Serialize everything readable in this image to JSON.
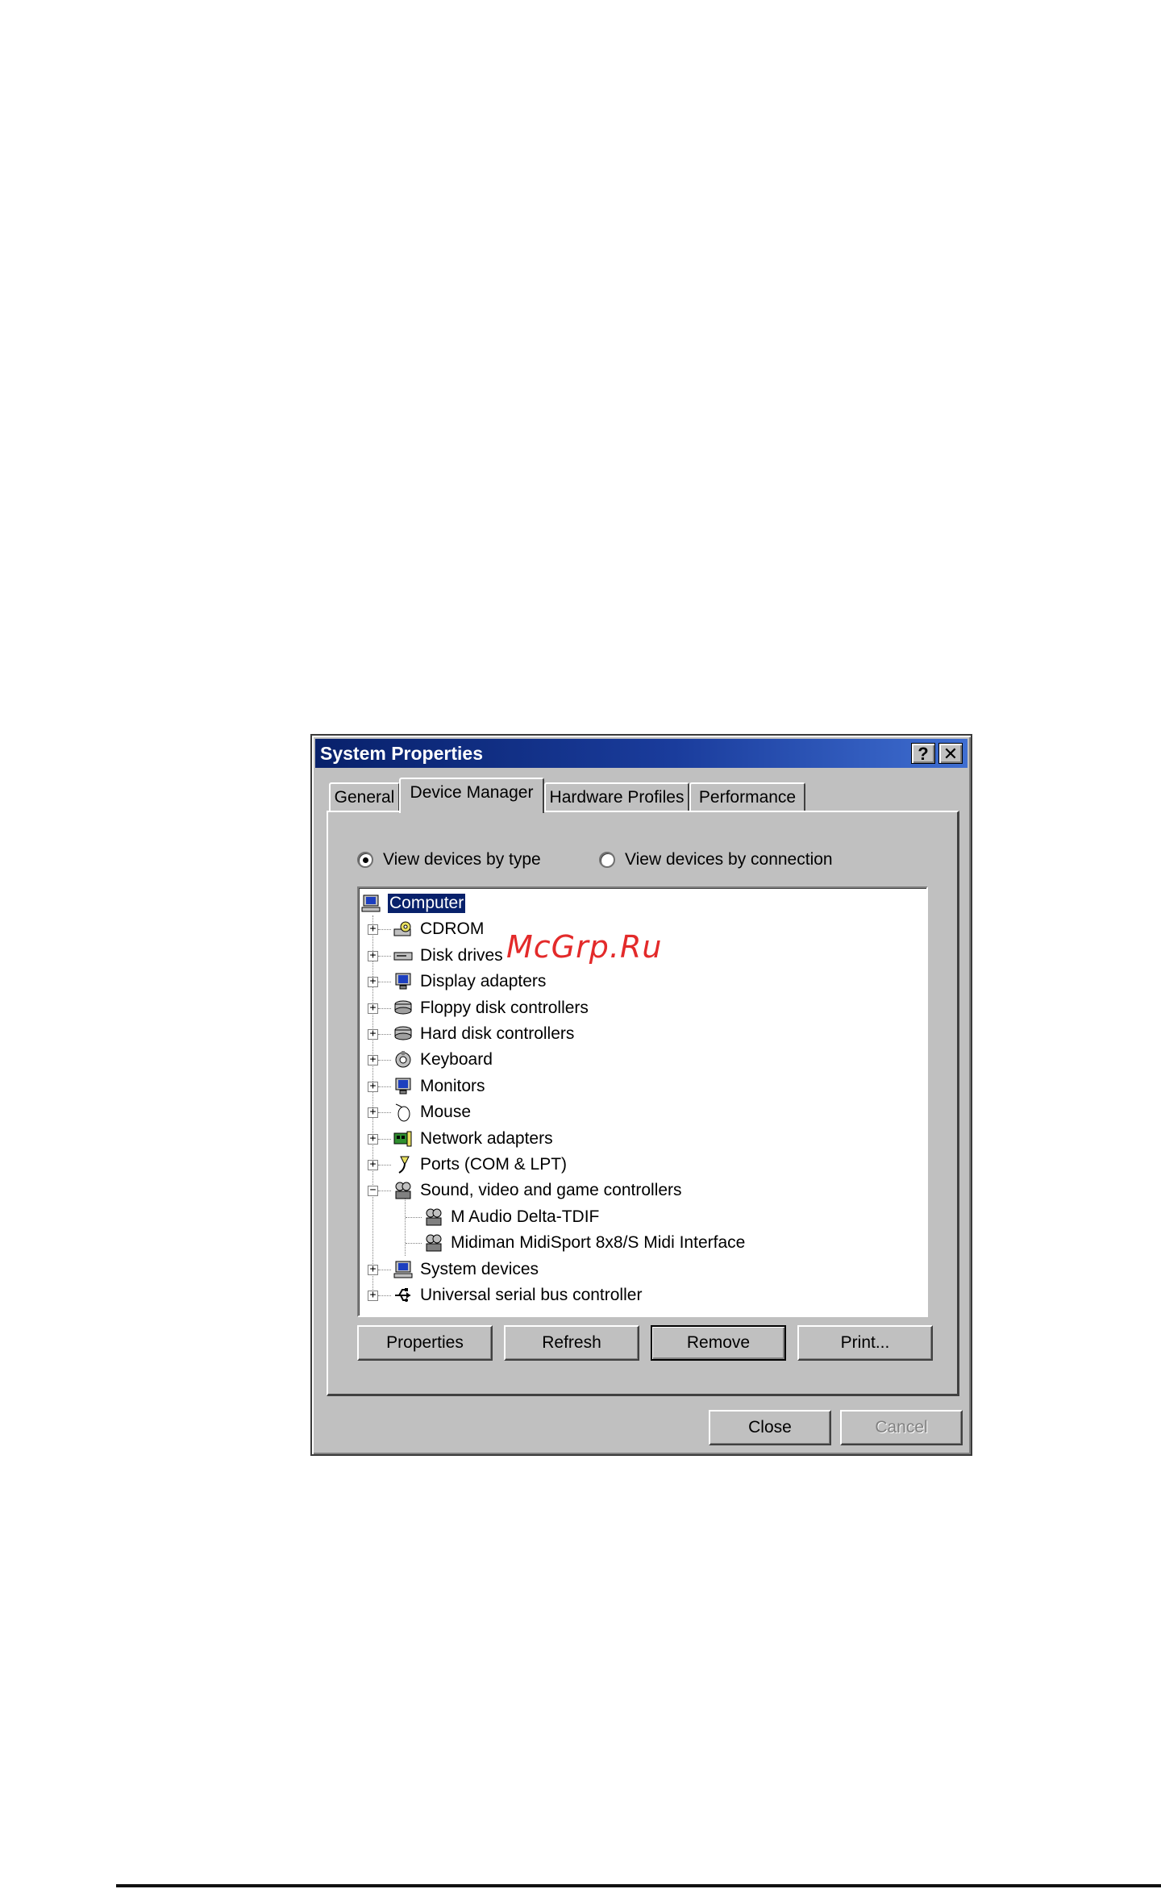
{
  "window": {
    "title": "System Properties",
    "help_glyph": "?",
    "close_glyph": "✕"
  },
  "tabs": [
    {
      "label": "General",
      "active": false
    },
    {
      "label": "Device Manager",
      "active": true
    },
    {
      "label": "Hardware Profiles",
      "active": false
    },
    {
      "label": "Performance",
      "active": false
    }
  ],
  "view_options": {
    "by_type": {
      "label": "View devices by type",
      "checked": true
    },
    "by_connection": {
      "label": "View devices by connection",
      "checked": false
    }
  },
  "tree": {
    "root": {
      "label": "Computer",
      "icon": "computer-icon",
      "selected": true
    },
    "items": [
      {
        "label": "CDROM",
        "icon": "cdrom-icon",
        "expanded": false
      },
      {
        "label": "Disk drives",
        "icon": "disk-drive-icon",
        "expanded": false
      },
      {
        "label": "Display adapters",
        "icon": "display-adapter-icon",
        "expanded": false
      },
      {
        "label": "Floppy disk controllers",
        "icon": "floppy-controller-icon",
        "expanded": false
      },
      {
        "label": "Hard disk controllers",
        "icon": "hard-disk-controller-icon",
        "expanded": false
      },
      {
        "label": "Keyboard",
        "icon": "keyboard-icon",
        "expanded": false
      },
      {
        "label": "Monitors",
        "icon": "monitor-icon",
        "expanded": false
      },
      {
        "label": "Mouse",
        "icon": "mouse-icon",
        "expanded": false
      },
      {
        "label": "Network adapters",
        "icon": "network-adapter-icon",
        "expanded": false
      },
      {
        "label": "Ports (COM & LPT)",
        "icon": "port-icon",
        "expanded": false
      },
      {
        "label": "Sound, video and game controllers",
        "icon": "sound-controller-icon",
        "expanded": true,
        "children": [
          {
            "label": "M Audio Delta-TDIF",
            "icon": "sound-device-icon"
          },
          {
            "label": "Midiman MidiSport 8x8/S Midi Interface",
            "icon": "sound-device-icon"
          }
        ]
      },
      {
        "label": "System devices",
        "icon": "system-device-icon",
        "expanded": false
      },
      {
        "label": "Universal serial bus controller",
        "icon": "usb-icon",
        "expanded": false
      }
    ]
  },
  "buttons": {
    "properties": "Properties",
    "refresh": "Refresh",
    "remove": "Remove",
    "print": "Print...",
    "close": "Close",
    "cancel": "Cancel"
  },
  "watermark": "McGrp.Ru",
  "colors": {
    "title_bar": "#08216b",
    "face": "#c0c0c0",
    "selection": "#08216b",
    "watermark": "#e32a2a"
  }
}
